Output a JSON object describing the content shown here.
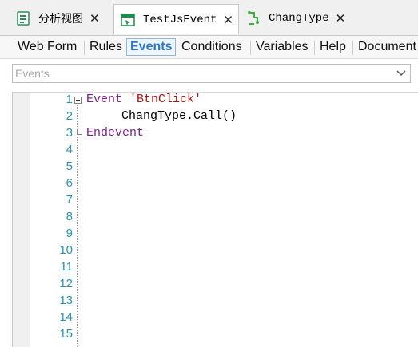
{
  "doc_tabs": [
    {
      "label": "分析视图",
      "icon": "analysis-view-icon",
      "close": "✕"
    },
    {
      "label": "TestJsEvent",
      "icon": "webform-icon",
      "close": "✕"
    },
    {
      "label": "ChangType",
      "icon": "procedure-icon",
      "close": "✕"
    }
  ],
  "sub_tabs": [
    {
      "label": "Web Form"
    },
    {
      "label": "Rules"
    },
    {
      "label": "Events"
    },
    {
      "label": "Conditions"
    },
    {
      "label": "Variables"
    },
    {
      "label": "Help"
    },
    {
      "label": "Document"
    }
  ],
  "event_combo": {
    "placeholder": "Events"
  },
  "editor": {
    "line_numbers": [
      "1",
      "2",
      "3",
      "4",
      "5",
      "6",
      "7",
      "8",
      "9",
      "10",
      "11",
      "12",
      "13",
      "14",
      "15"
    ],
    "lines": {
      "l1_kw": "Event",
      "l1_str": "'BtnClick'",
      "l2": "ChangType.Call()",
      "l3_kw": "Endevent"
    }
  },
  "colors": {
    "active_tab": "#2b78c5",
    "keyword": "#7a1f8a",
    "string": "#a31515",
    "line_number": "#2b91af"
  }
}
